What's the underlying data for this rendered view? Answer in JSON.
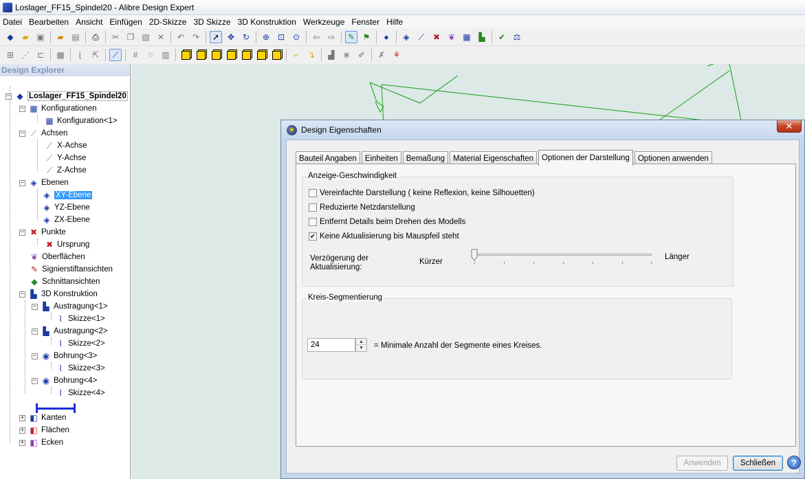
{
  "window": {
    "title": "Loslager_FF15_Spindel20 - Alibre Design Expert"
  },
  "menu": [
    "Datei",
    "Bearbeiten",
    "Ansicht",
    "Einfügen",
    "2D-Skizze",
    "3D Skizze",
    "3D Konstruktion",
    "Werkzeuge",
    "Fenster",
    "Hilfe"
  ],
  "explorer": {
    "header": "Design Explorer",
    "root": "Loslager_FF15_Spindel20",
    "items": {
      "konfigurationen": "Konfigurationen",
      "konfiguration1": "Konfiguration<1>",
      "achsen": "Achsen",
      "x_achse": "X-Achse",
      "y_achse": "Y-Achse",
      "z_achse": "Z-Achse",
      "ebenen": "Ebenen",
      "xy_ebene": "XY-Ebene",
      "yz_ebene": "YZ-Ebene",
      "zx_ebene": "ZX-Ebene",
      "punkte": "Punkte",
      "ursprung": "Ursprung",
      "oberflaechen": "Oberflächen",
      "signierstift": "Signierstiftansichten",
      "schnitt": "Schnittansichten",
      "konstruktion": "3D Konstruktion",
      "austragung1": "Austragung<1>",
      "skizze1": "Skizze<1>",
      "austragung2": "Austragung<2>",
      "skizze2": "Skizze<2>",
      "bohrung3": "Bohrung<3>",
      "skizze3": "Skizze<3>",
      "bohrung4": "Bohrung<4>",
      "skizze4": "Skizze<4>",
      "kanten": "Kanten",
      "flaechen": "Flächen",
      "ecken": "Ecken"
    }
  },
  "dialog": {
    "title": "Design Eigenschaften",
    "close_glyph": "✕",
    "tabs": [
      "Bauteil Angaben",
      "Einheiten",
      "Bemaßung",
      "Material Eigenschaften",
      "Optionen der Darstellung",
      "Optionen anwenden"
    ],
    "active_tab": 4,
    "group_speed": {
      "title": "Anzeige-Geschwindigkeit",
      "options": [
        {
          "label": "Vereinfachte Darstellung ( keine Reflexion, keine Silhouetten)",
          "checked": false
        },
        {
          "label": "Reduzierte Netzdarstellung",
          "checked": false
        },
        {
          "label": "Entfernt Details beim Drehen des Modells",
          "checked": false
        },
        {
          "label": "Keine Aktualisierung bis Mauspfeil steht",
          "checked": true
        }
      ],
      "delay_label_line1": "Verzögerung der",
      "delay_label_line2": "Aktualisierung:",
      "slider_min_label": "Kürzer",
      "slider_max_label": "Länger",
      "slider_value": 0
    },
    "group_circle": {
      "title": "Kreis-Segmentierung",
      "value": "24",
      "description": "= Minimale Anzahl der Segmente eines Kreises."
    },
    "buttons": {
      "apply": "Anwenden",
      "close": "Schließen",
      "help": "?"
    }
  },
  "colors": {
    "selection": "#3399ff",
    "canvas": "#dde9e6",
    "sketch_line": "#1a9a1a"
  }
}
